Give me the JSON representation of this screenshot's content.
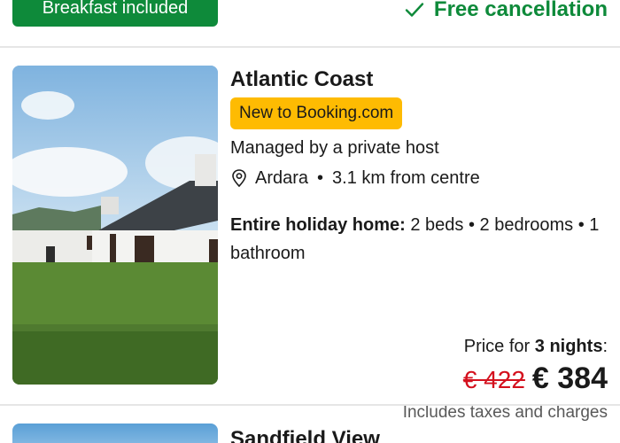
{
  "top": {
    "breakfast_label": "Breakfast included",
    "free_cancellation_label": "Free cancellation"
  },
  "listing": {
    "title": "Atlantic Coast",
    "badge": "New to Booking.com",
    "host": "Managed by a private host",
    "location_town": "Ardara",
    "location_separator": "•",
    "location_distance": "3.1 km from centre",
    "details_type": "Entire holiday home:",
    "details_text": "2 beds • 2 bedrooms • 1 bathroom",
    "price_label_prefix": "Price for",
    "price_label_nights": "3 nights",
    "price_label_suffix": ":",
    "old_price": "€ 422",
    "new_price": "€ 384",
    "taxes_note": "Includes taxes and charges"
  },
  "next_listing": {
    "title": "Sandfield View"
  },
  "colors": {
    "green": "#0e8a3a",
    "badge_yellow": "#febb02",
    "strike_red": "#d4111e"
  }
}
